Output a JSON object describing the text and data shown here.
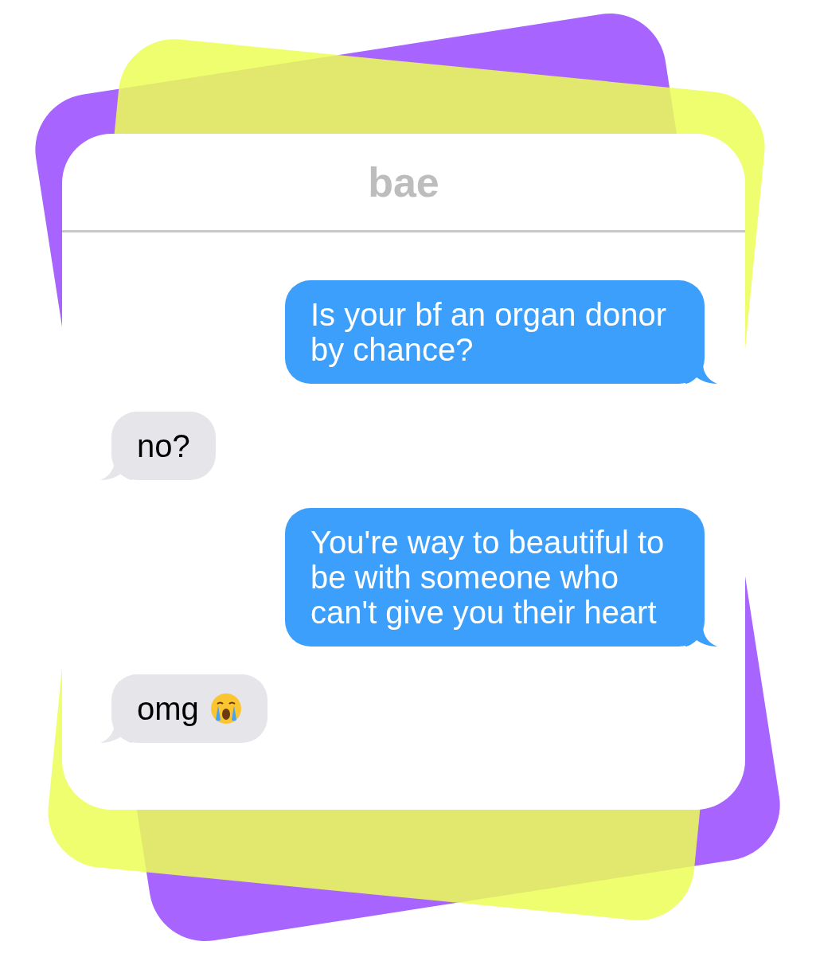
{
  "chat": {
    "title": "bae",
    "messages": [
      {
        "kind": "sent",
        "text": "Is your bf an organ donor by chance?",
        "has_emoji": false
      },
      {
        "kind": "received",
        "text": "no?",
        "has_emoji": false
      },
      {
        "kind": "sent",
        "text": "You're way to beautiful to be with someone who can't give you their heart",
        "has_emoji": false
      },
      {
        "kind": "received",
        "text": "omg",
        "has_emoji": true
      }
    ]
  }
}
